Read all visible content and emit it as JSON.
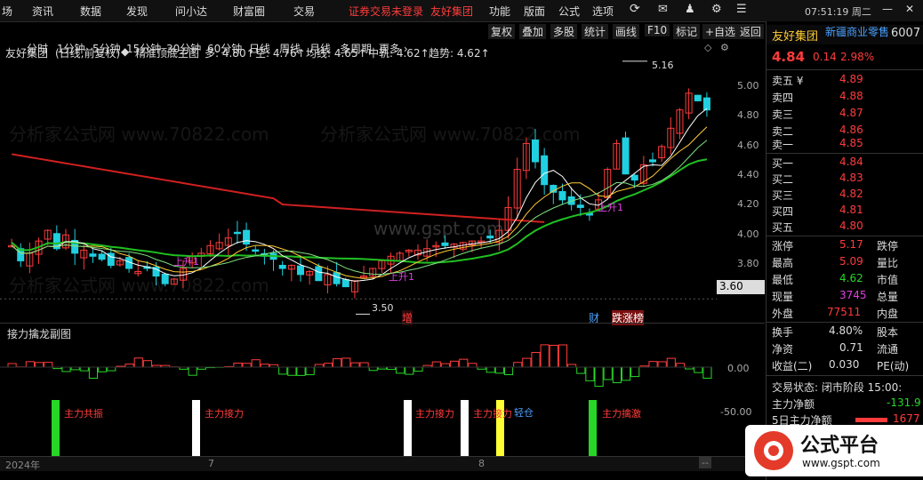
{
  "menu": {
    "items": [
      "场",
      "资讯",
      "数据",
      "发现",
      "问小达",
      "财富圈",
      "交易"
    ],
    "login_status": "证券交易未登录",
    "stock_short": "友好集团",
    "right_items": [
      "功能",
      "版面",
      "公式",
      "选项"
    ],
    "clock": "07:51:19 周二"
  },
  "chart_header": {
    "stock": "友好集团",
    "mode": "(日线,前复权)",
    "diamond": "◆",
    "formula": "精准顶底主图",
    "duo": "多: 4.80↑",
    "kong": "空: 4.76↑",
    "junxian": "均线: 4.65↑",
    "zhonggui": "中轨: 4.62↑",
    "qushi": "趋势: 4.62↑"
  },
  "right_tools": [
    "复权",
    "叠加",
    "多股",
    "统计",
    "画线",
    "F10",
    "标记",
    "+自选",
    "返回"
  ],
  "periods": [
    "分时",
    "1分钟",
    "5分钟",
    "15分钟",
    "30分钟",
    "60分钟",
    "日线",
    "周线",
    "月线",
    "多周期",
    "更多 ›"
  ],
  "active_period": "日线",
  "price_axis": [
    "5.00",
    "4.80",
    "4.60",
    "4.40",
    "4.20",
    "4.00",
    "3.80"
  ],
  "crosshair_price": "3.60",
  "high_label": "5.16",
  "low_label": "3.50",
  "tags": {
    "zeng": "增",
    "cai": "财",
    "diezhang": "跌涨榜"
  },
  "up_labels": [
    "上升1",
    "上升1",
    "上升1"
  ],
  "sub_title": "接力擒龙副图",
  "sub_axis": [
    "0.00",
    "-50.00"
  ],
  "signals": [
    "主力共振",
    "主力接力",
    "主力接力",
    "主力接力",
    "轻仓",
    "主力擒激"
  ],
  "date_axis": {
    "start": "2024年",
    "m7": "7",
    "m8": "8"
  },
  "watermarks": [
    "分析家公式网 www.70822.com",
    "分析家公式网 www.70822.com",
    "www.gspt.com"
  ],
  "quote": {
    "name": "友好集团",
    "sector": "新疆商业零售",
    "code": "6007",
    "price": "4.84",
    "change": "0.14",
    "pct": "2.98%",
    "asks": [
      {
        "label": "卖五 ¥",
        "price": "4.89"
      },
      {
        "label": "卖四",
        "price": "4.88"
      },
      {
        "label": "卖三",
        "price": "4.87"
      },
      {
        "label": "卖二",
        "price": "4.86"
      },
      {
        "label": "卖一",
        "price": "4.85"
      }
    ],
    "bids": [
      {
        "label": "买一",
        "price": "4.84"
      },
      {
        "label": "买二",
        "price": "4.83"
      },
      {
        "label": "买三",
        "price": "4.82"
      },
      {
        "label": "买四",
        "price": "4.81"
      },
      {
        "label": "买五",
        "price": "4.80"
      }
    ],
    "stats": [
      {
        "k": "涨停",
        "v": "5.17",
        "k2": "跌停"
      },
      {
        "k": "最高",
        "v": "5.09",
        "k2": "量比"
      },
      {
        "k": "最低",
        "v": "4.62",
        "k2": "市值"
      },
      {
        "k": "现量",
        "v": "3745",
        "k2": "总量"
      },
      {
        "k": "外盘",
        "v": "77511",
        "k2": "内盘"
      }
    ],
    "stats2": [
      {
        "k": "换手",
        "v": "4.80%",
        "k2": "股本"
      },
      {
        "k": "净资",
        "v": "0.71",
        "k2": "流通"
      },
      {
        "k": "收益(二)",
        "v": "0.030",
        "k2": "PE(动)"
      }
    ],
    "trade_state": "交易状态: 闭市阶段 15:00:",
    "main_net": "主力净额",
    "main_net_val": "-131.9",
    "main_net5": "5日主力净额",
    "main_net5_val": "1677"
  },
  "logo": {
    "text": "公式平台",
    "url": "www.gspt.com"
  },
  "colors": {
    "up": "#ff3b3b",
    "down": "#27d627",
    "neutral": "#dddddd",
    "accent": "#ffcc33"
  }
}
